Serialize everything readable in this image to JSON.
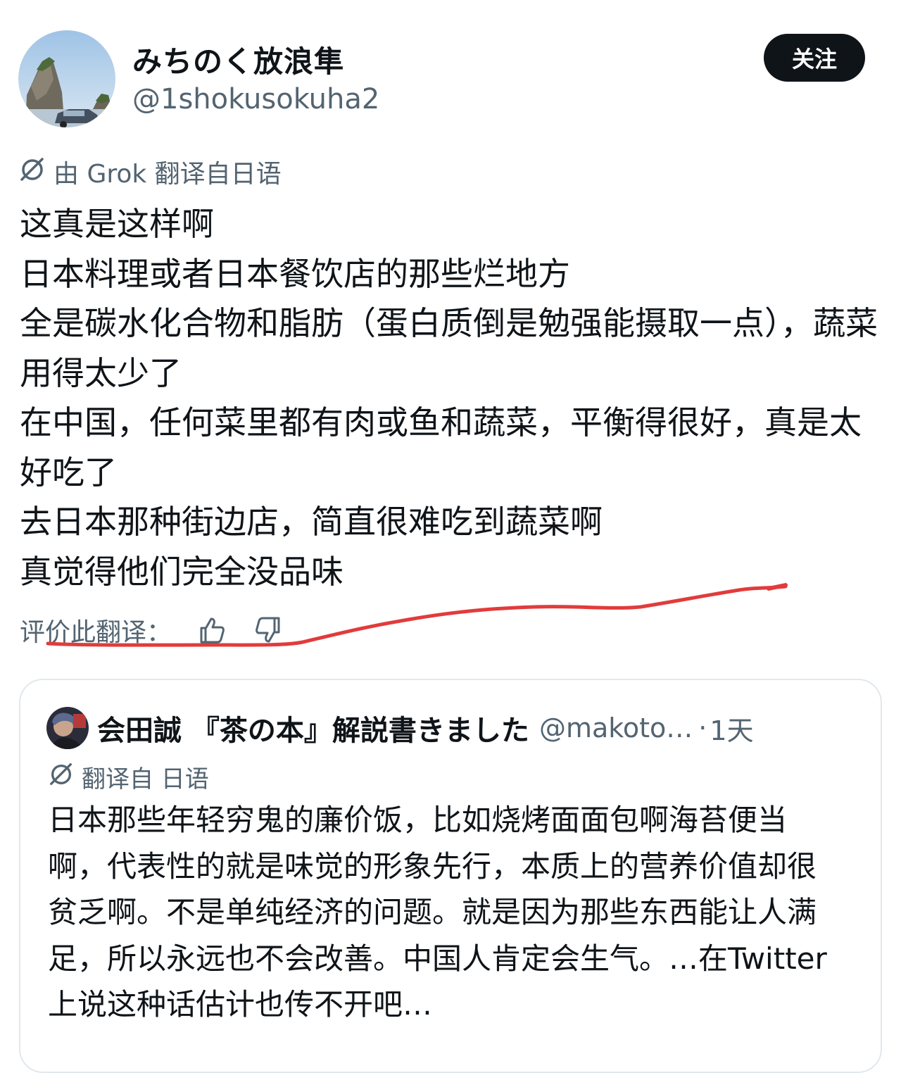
{
  "author": {
    "display_name": "みちのく放浪隼",
    "handle": "@1shokusokuha2"
  },
  "follow_button_label": "关注",
  "translation_note": "由 Grok 翻译自日语",
  "tweet_text": "这真是这样啊\n日本料理或者日本餐饮店的那些烂地方\n全是碳水化合物和脂肪（蛋白质倒是勉强能摄取一点），蔬菜用得太少了\n在中国，任何菜里都有肉或鱼和蔬菜，平衡得很好，真是太好吃了\n去日本那种街边店，简直很难吃到蔬菜啊\n真觉得他们完全没品味",
  "rate_translation_label": "评价此翻译：",
  "icons": {
    "translate": "grok-translate-icon",
    "thumbs_up": "thumbs-up-icon",
    "thumbs_down": "thumbs-down-icon"
  },
  "quoted_tweet": {
    "author_name": "会田誠 『茶の本』解説書きました",
    "handle": "@makoto…",
    "separator": "·",
    "time": "1天",
    "translation_note": "翻译自 日语",
    "text": "日本那些年轻穷鬼的廉价饭，比如烧烤面面包啊海苔便当啊，代表性的就是味觉的形象先行，本质上的营养价值却很贫乏啊。不是单纯经济的问题。就是因为那些东西能让人满足，所以永远也不会改善。中国人肯定会生气。…在Twitter上说这种话估计也传不开吧…"
  },
  "colors": {
    "primary_text": "#0f1419",
    "secondary_text": "#536471",
    "follow_button_bg": "#0f1419",
    "card_border": "#e1e8ed",
    "annotation_red": "#e23b3b"
  }
}
